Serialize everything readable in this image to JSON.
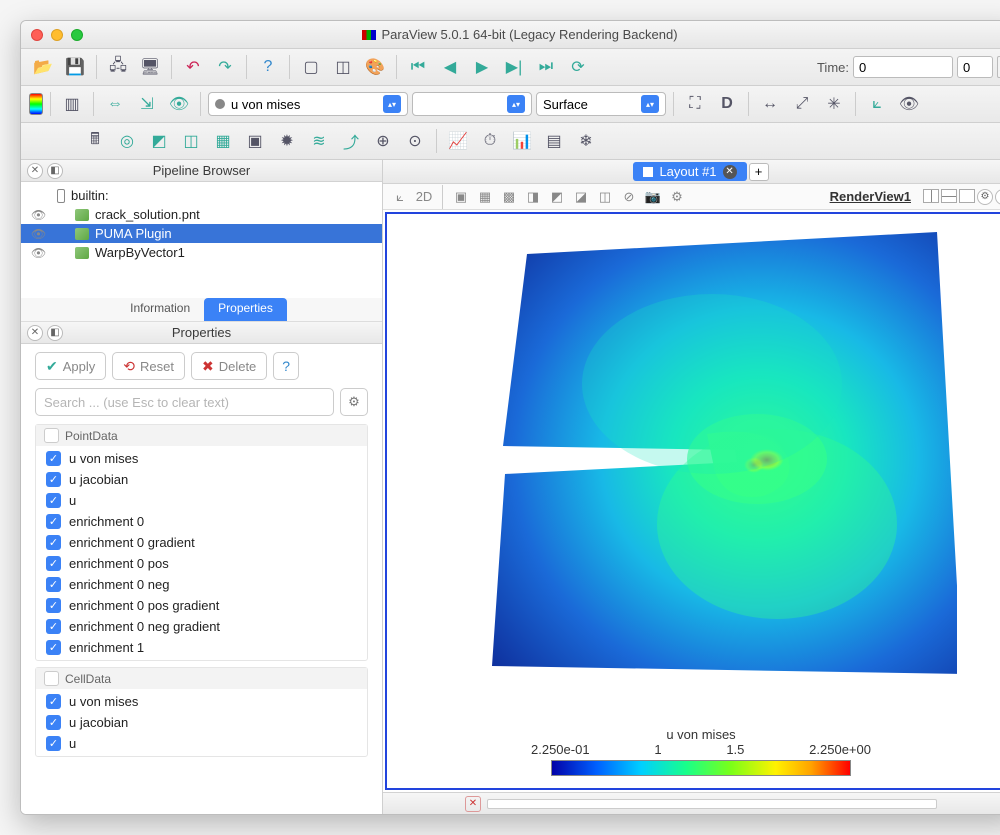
{
  "title": "ParaView 5.0.1 64-bit (Legacy Rendering Backend)",
  "toolbar": {
    "time_label": "Time:",
    "time_value": "0",
    "time_step": "0"
  },
  "field_selector": {
    "coloring_field": "u von mises",
    "component": "",
    "representation": "Surface"
  },
  "pipeline": {
    "title": "Pipeline Browser",
    "items": [
      {
        "label": "builtin:",
        "icon": "server",
        "indent": 0,
        "visible": false,
        "eye": false
      },
      {
        "label": "crack_solution.pnt",
        "icon": "cube",
        "indent": 1,
        "visible": true,
        "eye": true
      },
      {
        "label": "PUMA Plugin",
        "icon": "cube",
        "indent": 1,
        "visible": true,
        "eye": true,
        "selected": true
      },
      {
        "label": "WarpByVector1",
        "icon": "cube",
        "indent": 1,
        "visible": true,
        "eye": true
      }
    ]
  },
  "tabs": {
    "info": "Information",
    "props": "Properties"
  },
  "properties": {
    "title": "Properties",
    "apply": "Apply",
    "reset": "Reset",
    "delete": "Delete",
    "search_placeholder": "Search ... (use Esc to clear text)",
    "groups": [
      {
        "name": "PointData",
        "items": [
          "u von mises",
          "u jacobian",
          "u",
          "enrichment 0",
          "enrichment 0 gradient",
          "enrichment 0 pos",
          "enrichment 0 neg",
          "enrichment 0 pos gradient",
          "enrichment 0 neg gradient",
          "enrichment 1"
        ]
      },
      {
        "name": "CellData",
        "items": [
          "u von mises",
          "u jacobian",
          "u"
        ]
      }
    ]
  },
  "layout": {
    "tab": "Layout #1",
    "view_name": "RenderView1"
  },
  "colorbar": {
    "title": "u von mises",
    "ticks": [
      "2.250e-01",
      "1",
      "1.5",
      "2.250e+00"
    ]
  }
}
